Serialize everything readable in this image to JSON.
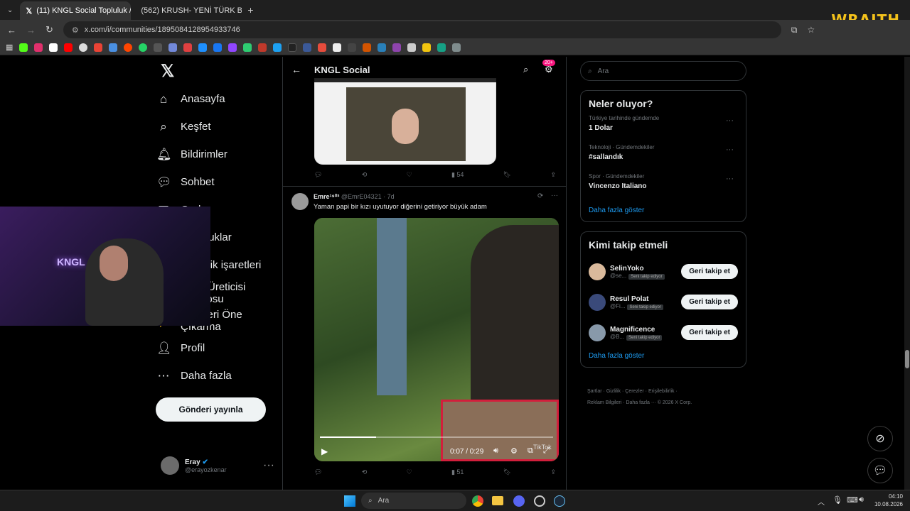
{
  "browser": {
    "tabs": [
      {
        "label": "(11) KNGL Social Topluluk / X",
        "active": true
      },
      {
        "label": "(562) KRUSH- YENİ TÜRK BOYB",
        "active": false
      }
    ],
    "url": "x.com/i/communities/1895084128954933746",
    "overlay_brand": "WRAITH"
  },
  "nav": {
    "items": [
      {
        "label": "Anasayfa",
        "icon": "home-icon"
      },
      {
        "label": "Keşfet",
        "icon": "search-icon"
      },
      {
        "label": "Bildirimler",
        "icon": "bell-icon"
      },
      {
        "label": "Sohbet",
        "icon": "chat-icon"
      },
      {
        "label": "Grok",
        "icon": "grok-icon"
      },
      {
        "label": "Topluluklar",
        "icon": "community-icon"
      },
      {
        "label": "Sahiplik işaretleri",
        "icon": "bookmark-icon"
      },
      {
        "label": "İçerik Üreticisi Stüdyosu",
        "icon": "studio-icon"
      },
      {
        "label": "Profilleri Öne Çıkarma",
        "icon": "premium-icon"
      },
      {
        "label": "Profil",
        "icon": "profile-icon"
      },
      {
        "label": "Daha fazla",
        "icon": "more-icon"
      }
    ],
    "post_button": "Gönderi yayınla",
    "user": {
      "name": "Eray",
      "handle": "@erayozkenar"
    }
  },
  "feed": {
    "title": "KNGL Social",
    "badge": "20+",
    "post1": {
      "views": "54"
    },
    "post2": {
      "author": "Emre¹⁹⁰³",
      "handle": "@EmrE04321",
      "time": "· 7d",
      "text": "Yaman papi bir kızı uyutuyor diğerini getiriyor büyük adam",
      "video_time": "0:07 / 0:29",
      "views": "51",
      "watermark": "TikTok"
    }
  },
  "sidebar": {
    "search_placeholder": "Ara",
    "trends_title": "Neler oluyor?",
    "trends": [
      {
        "meta": "Türkiye tarihinde gündemde",
        "name": "1 Dolar"
      },
      {
        "meta": "Teknoloji · Gündemdekiler",
        "name": "#sallandık"
      },
      {
        "meta": "Spor · Gündemdekiler",
        "name": "Vincenzo Italiano"
      }
    ],
    "show_more": "Daha fazla göster",
    "who_title": "Kimi takip etmeli",
    "who": [
      {
        "name": "SelinYoko",
        "handle": "@se...",
        "badge": "Seni takip ediyor",
        "button": "Geri takip et"
      },
      {
        "name": "Resul Polat",
        "handle": "@Fi...",
        "badge": "Seni takip ediyor",
        "button": "Geri takip et"
      },
      {
        "name": "Magnificence",
        "handle": "@B...",
        "badge": "Seni takip ediyor",
        "button": "Geri takip et"
      }
    ],
    "footer_line1": "Şartlar  ·  Gizlilik  ·  Çerezler  ·  Erişilebilirlik  ·",
    "footer_line2": "Reklam Bilgileri  ·  Daha fazla ···  © 2026 X Corp."
  },
  "taskbar": {
    "search": "Ara",
    "time": "04:10",
    "date": "10.08.2026"
  },
  "colors": {
    "accent": "#1d9bf0",
    "badge": "#f91880",
    "bg": "#000000"
  }
}
